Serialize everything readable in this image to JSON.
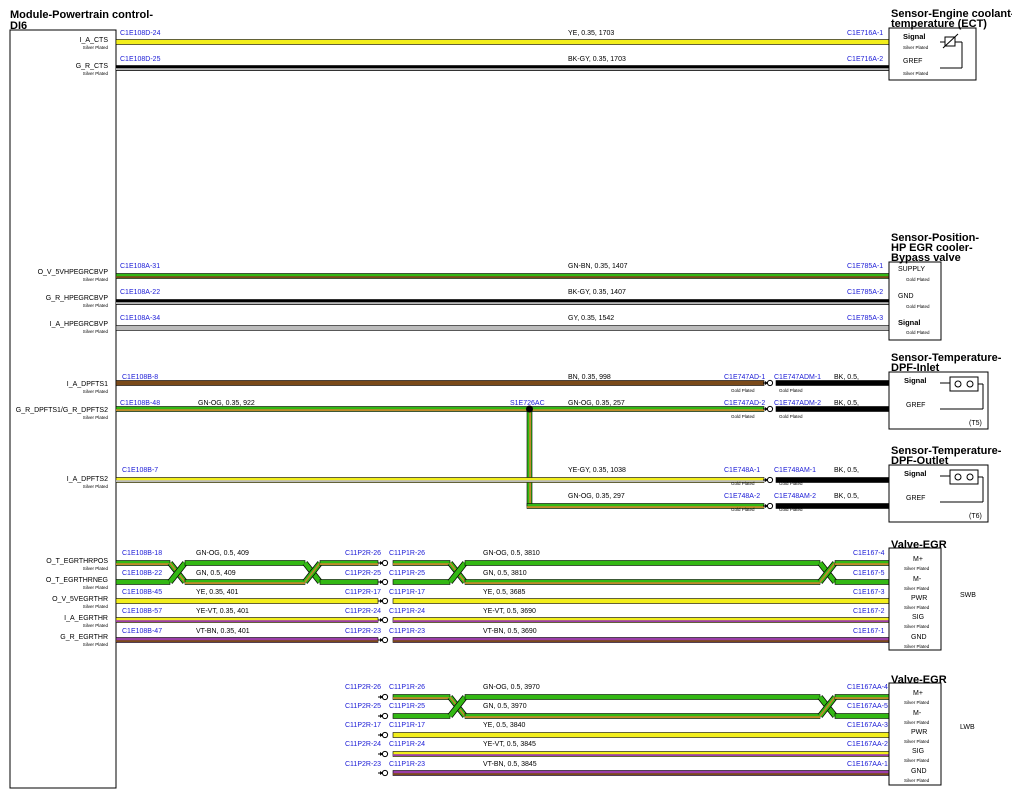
{
  "module": {
    "title_line1": "Module-Powertrain control-",
    "title_line2": "DI6"
  },
  "plating": {
    "silver": "Silver Plated",
    "gold": "Gold Plated"
  },
  "colors": {
    "YE": "#f2ee1c",
    "BK": "#000000",
    "GN": "#33b814",
    "GY": "#bbbbbb",
    "BN": "#7a4a1a",
    "OG": "#c08a2a",
    "VT": "#9b3da8",
    "WH": "#ffffff"
  },
  "ect": {
    "title_line1": "Sensor-Engine coolant-",
    "title_line2": "temperature (ECT)",
    "wires": [
      {
        "signal": "I_A_CTS",
        "left": "C1E108D-24",
        "spec": "YE,  0.35,  1703",
        "right": "C1E716A-1",
        "pin": "Signal"
      },
      {
        "signal": "G_R_CTS",
        "left": "C1E108D-25",
        "spec": "BK-GY,  0.35,  1703",
        "right": "C1E716A-2",
        "pin": "GREF"
      }
    ]
  },
  "egr_bypass": {
    "title_line1": "Sensor-Position-",
    "title_line2": "HP EGR cooler-",
    "title_line3": "Bypass valve",
    "wires": [
      {
        "signal": "O_V_5VHPEGRCBVP",
        "left": "C1E108A-31",
        "spec": "GN-BN,  0.35,  1407",
        "right": "C1E785A-1",
        "pin": "SUPPLY"
      },
      {
        "signal": "G_R_HPEGRCBVP",
        "left": "C1E108A-22",
        "spec": "BK-GY,  0.35,  1407",
        "right": "C1E785A-2",
        "pin": "GND"
      },
      {
        "signal": "I_A_HPEGRCBVP",
        "left": "C1E108A-34",
        "spec": "GY,  0.35,  1542",
        "right": "C1E785A-3",
        "pin": "Signal"
      }
    ]
  },
  "dpf_inlet": {
    "title_line1": "Sensor-Temperature-",
    "title_line2": "DPF-Inlet",
    "tag": "(T5)",
    "wires": [
      {
        "signal": "I_A_DPFTS1",
        "left": "C1E108B-8",
        "spec": "BN,  0.35,  998",
        "c1": "C1E747AD-1",
        "c2": "C1E747ADM-1",
        "spec2": "BK,  0.5,",
        "pin": "Signal"
      },
      {
        "signal": "G_R_DPFTS1/G_R_DPFTS2",
        "left": "C1E108B-48",
        "spec0": "GN-OG,  0.35,  922",
        "splice": "S1E726AC",
        "spec": "GN-OG,  0.35,  257",
        "c1": "C1E747AD-2",
        "c2": "C1E747ADM-2",
        "spec2": "BK,  0.5,",
        "pin": "GREF"
      }
    ]
  },
  "dpf_outlet": {
    "title_line1": "Sensor-Temperature-",
    "title_line2": "DPF-Outlet",
    "tag": "(T6)",
    "wires": [
      {
        "signal": "I_A_DPFTS2",
        "left": "C1E108B-7",
        "spec": "YE-GY,  0.35,  1038",
        "c1": "C1E748A-1",
        "c2": "C1E748AM-1",
        "spec2": "BK,  0.5,",
        "pin": "Signal"
      },
      {
        "spec": "GN-OG,  0.35,  297",
        "c1": "C1E748A-2",
        "c2": "C1E748AM-2",
        "spec2": "BK,  0.5,",
        "pin": "GREF"
      }
    ]
  },
  "valve_swb": {
    "title": "Valve-EGR",
    "tag": "SWB",
    "wires": [
      {
        "signal": "O_T_EGRTHRPOS",
        "left": "C1E108B-18",
        "spec0": "GN-OG,  0.5,  409",
        "m1": "C11P2R-26",
        "m2": "C11P1R-26",
        "spec": "GN-OG,  0.5,  3810",
        "right": "C1E167-4",
        "pin": "M+"
      },
      {
        "signal": "O_T_EGRTHRNEG",
        "left": "C1E108B-22",
        "spec0": "GN,  0.5,  409",
        "m1": "C11P2R-25",
        "m2": "C11P1R-25",
        "spec": "GN,  0.5,  3810",
        "right": "C1E167-5",
        "pin": "M-"
      },
      {
        "signal": "O_V_5VEGRTHR",
        "left": "C1E108B-45",
        "spec0": "YE,  0.35,  401",
        "m1": "C11P2R-17",
        "m2": "C11P1R-17",
        "spec": "YE,  0.5,  3685",
        "right": "C1E167-3",
        "pin": "PWR"
      },
      {
        "signal": "I_A_EGRTHR",
        "left": "C1E108B-57",
        "spec0": "YE-VT,  0.35,  401",
        "m1": "C11P2R-24",
        "m2": "C11P1R-24",
        "spec": "YE-VT,  0.5,  3690",
        "right": "C1E167-2",
        "pin": "SIG"
      },
      {
        "signal": "G_R_EGRTHR",
        "left": "C1E108B-47",
        "spec0": "VT-BN,  0.35,  401",
        "m1": "C11P2R-23",
        "m2": "C11P1R-23",
        "spec": "VT-BN,  0.5,  3690",
        "right": "C1E167-1",
        "pin": "GND"
      }
    ]
  },
  "valve_lwb": {
    "title": "Valve-EGR",
    "tag": "LWB",
    "wires": [
      {
        "m1": "C11P2R-26",
        "m2": "C11P1R-26",
        "spec": "GN-OG,  0.5,  3970",
        "right": "C1E167AA-4",
        "pin": "M+"
      },
      {
        "m1": "C11P2R-25",
        "m2": "C11P1R-25",
        "spec": "GN,  0.5,  3970",
        "right": "C1E167AA-5",
        "pin": "M-"
      },
      {
        "m1": "C11P2R-17",
        "m2": "C11P1R-17",
        "spec": "YE,  0.5,  3840",
        "right": "C1E167AA-3",
        "pin": "PWR"
      },
      {
        "m1": "C11P2R-24",
        "m2": "C11P1R-24",
        "spec": "YE-VT,  0.5,  3845",
        "right": "C1E167AA-2",
        "pin": "SIG"
      },
      {
        "m1": "C11P2R-23",
        "m2": "C11P1R-23",
        "spec": "VT-BN,  0.5,  3845",
        "right": "C1E167AA-1",
        "pin": "GND"
      }
    ]
  }
}
